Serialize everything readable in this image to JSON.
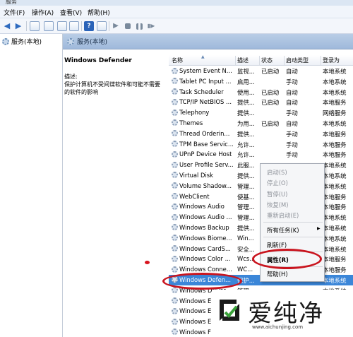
{
  "window": {
    "title": "服务"
  },
  "menu": [
    "文件(F)",
    "操作(A)",
    "查看(V)",
    "帮助(H)"
  ],
  "tree": {
    "root_label": "服务(本地)"
  },
  "header": {
    "title": "服务(本地)"
  },
  "detail": {
    "service_name": "Windows Defender",
    "desc_label": "描述:",
    "desc_text": "保护计算机不受间谍软件和可能不需要的软件的影响"
  },
  "columns": [
    "名称",
    "描述",
    "状态",
    "启动类型",
    "登录为"
  ],
  "services": [
    {
      "name": "System Event N...",
      "desc": "监视...",
      "status": "已启动",
      "startup": "自动",
      "logon": "本地系统"
    },
    {
      "name": "Tablet PC Input ...",
      "desc": "启用...",
      "status": "",
      "startup": "手动",
      "logon": "本地系统"
    },
    {
      "name": "Task Scheduler",
      "desc": "使用...",
      "status": "已启动",
      "startup": "自动",
      "logon": "本地系统"
    },
    {
      "name": "TCP/IP NetBIOS ...",
      "desc": "提供...",
      "status": "已启动",
      "startup": "自动",
      "logon": "本地服务"
    },
    {
      "name": "Telephony",
      "desc": "提供...",
      "status": "",
      "startup": "手动",
      "logon": "网络服务"
    },
    {
      "name": "Themes",
      "desc": "为用...",
      "status": "已启动",
      "startup": "自动",
      "logon": "本地系统"
    },
    {
      "name": "Thread Orderin...",
      "desc": "提供...",
      "status": "",
      "startup": "手动",
      "logon": "本地服务"
    },
    {
      "name": "TPM Base Servic...",
      "desc": "允许...",
      "status": "",
      "startup": "手动",
      "logon": "本地服务"
    },
    {
      "name": "UPnP Device Host",
      "desc": "允许...",
      "status": "",
      "startup": "手动",
      "logon": "本地服务"
    },
    {
      "name": "User Profile Serv...",
      "desc": "此服...",
      "status": "",
      "startup": "",
      "logon": "本地系统"
    },
    {
      "name": "Virtual Disk",
      "desc": "提供...",
      "status": "",
      "startup": "",
      "logon": "本地系统"
    },
    {
      "name": "Volume Shadow...",
      "desc": "管理...",
      "status": "",
      "startup": "",
      "logon": "本地系统"
    },
    {
      "name": "WebClient",
      "desc": "使基...",
      "status": "",
      "startup": "",
      "logon": "本地服务"
    },
    {
      "name": "Windows Audio",
      "desc": "管理...",
      "status": "",
      "startup": "",
      "logon": "本地服务"
    },
    {
      "name": "Windows Audio ...",
      "desc": "管理...",
      "status": "",
      "startup": "",
      "logon": "本地系统"
    },
    {
      "name": "Windows Backup",
      "desc": "提供...",
      "status": "",
      "startup": "",
      "logon": "本地系统"
    },
    {
      "name": "Windows Biome...",
      "desc": "Win...",
      "status": "",
      "startup": "",
      "logon": "本地系统"
    },
    {
      "name": "Windows CardS...",
      "desc": "安全...",
      "status": "",
      "startup": "",
      "logon": "本地系统"
    },
    {
      "name": "Windows Color ...",
      "desc": "Wcs...",
      "status": "",
      "startup": "",
      "logon": "本地服务"
    },
    {
      "name": "Windows Conne...",
      "desc": "WC...",
      "status": "",
      "startup": "",
      "logon": "本地服务"
    },
    {
      "name": "Windows Defen...",
      "desc": "保护...",
      "status": "",
      "startup": "",
      "logon": "本地系统"
    },
    {
      "name": "Windows Driver ...",
      "desc": "管理...",
      "status": "",
      "startup": "",
      "logon": "本地系统"
    },
    {
      "name": "Windows E",
      "desc": "",
      "status": "",
      "startup": "",
      "logon": ""
    },
    {
      "name": "Windows E",
      "desc": "",
      "status": "",
      "startup": "",
      "logon": ""
    },
    {
      "name": "Windows E",
      "desc": "",
      "status": "",
      "startup": "",
      "logon": ""
    },
    {
      "name": "Windows F",
      "desc": "",
      "status": "",
      "startup": "",
      "logon": ""
    }
  ],
  "context_menu": {
    "start": "启动(S)",
    "stop": "停止(O)",
    "pause": "暂停(U)",
    "resume": "恢复(M)",
    "restart": "重新启动(E)",
    "all_tasks": "所有任务(K)",
    "refresh": "刷新(F)",
    "properties": "属性(R)",
    "help": "帮助(H)"
  },
  "watermark": {
    "brand": "爱纯净",
    "url": "www.aichunjing.com"
  },
  "colors": {
    "selection": "#3b86d8",
    "annotation": "#c9141e",
    "header": "#a9c1e0"
  }
}
